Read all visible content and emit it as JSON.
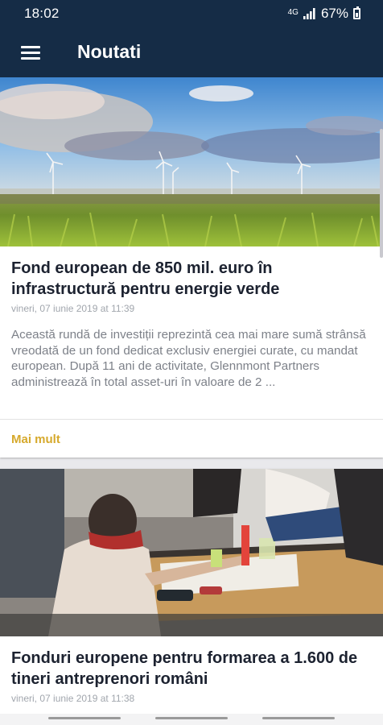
{
  "status": {
    "time": "18:02",
    "network": "4G",
    "battery": "67%"
  },
  "app": {
    "title": "Noutati"
  },
  "articles": [
    {
      "title": "Fond european de 850 mil. euro în infrastructură pentru energie verde",
      "date": "vineri, 07 iunie 2019 at 11:39",
      "excerpt": "Această rundă de investiții reprezintă cea mai mare sumă strânsă vreodată de un fond dedicat exclusiv energiei curate, cu mandat european. După 11 ani de activitate, Glennmont Partners administrează în total asset-uri în valoare de 2 ...",
      "more_label": "Mai mult",
      "image": "wind-turbines-field"
    },
    {
      "title": "Fonduri europene pentru formarea a 1.600 de tineri antreprenori români",
      "date": "vineri, 07 iunie 2019 at 11:38",
      "image": "team-meeting-table"
    }
  ],
  "colors": {
    "app_bar": "#152c46",
    "accent": "#d6a92c",
    "background": "#e9e9ec"
  }
}
